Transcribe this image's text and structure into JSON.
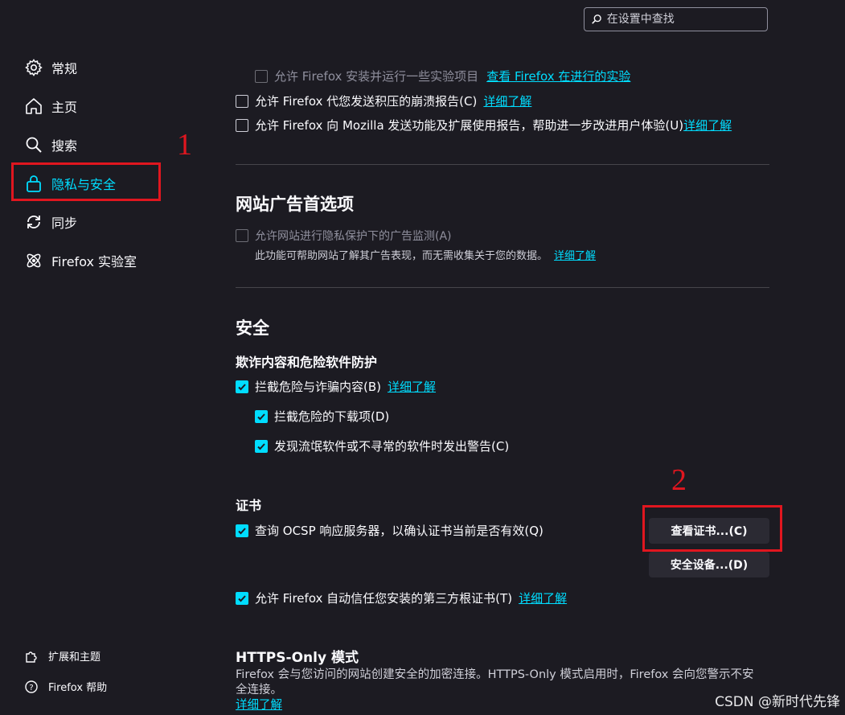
{
  "search": {
    "placeholder": "在设置中查找"
  },
  "sidebar": {
    "items": [
      {
        "label": "常规",
        "icon": "gear-icon"
      },
      {
        "label": "主页",
        "icon": "home-icon"
      },
      {
        "label": "搜索",
        "icon": "search-icon"
      },
      {
        "label": "隐私与安全",
        "icon": "lock-icon",
        "active": true
      },
      {
        "label": "同步",
        "icon": "sync-icon"
      },
      {
        "label": "Firefox 实验室",
        "icon": "flask-icon"
      }
    ],
    "footer": [
      {
        "label": "扩展和主题",
        "icon": "puzzle-icon"
      },
      {
        "label": "Firefox 帮助",
        "icon": "help-icon"
      }
    ]
  },
  "annotations": {
    "one": "1",
    "two": "2",
    "color": "#e0161f"
  },
  "data_collection": {
    "studies_label": "允许 Firefox 安装并运行一些实验项目",
    "studies_link": "查看 Firefox 在进行的实验",
    "crash_label": "允许 Firefox 代您发送积压的崩溃报告(C)",
    "crash_link": "详细了解",
    "telemetry_label": "允许 Firefox 向 Mozilla 发送功能及扩展使用报告，帮助进一步改进用户体验(U)",
    "telemetry_link": "详细了解"
  },
  "ads": {
    "title": "网站广告首选项",
    "ppa_label": "允许网站进行隐私保护下的广告监测(A)",
    "ppa_desc": "此功能可帮助网站了解其广告表现，而无需收集关于您的数据。",
    "ppa_link": "详细了解"
  },
  "security": {
    "title": "安全",
    "phishing_title": "欺诈内容和危险软件防护",
    "block_dangerous": "拦截危险与诈骗内容(B)",
    "block_link": "详细了解",
    "block_downloads": "拦截危险的下载项(D)",
    "warn_unwanted": "发现流氓软件或不寻常的软件时发出警告(C)"
  },
  "certificates": {
    "title": "证书",
    "ocsp_label": "查询 OCSP 响应服务器，以确认证书当前是否有效(Q)",
    "view_button": "查看证书...(C)",
    "devices_button": "安全设备...(D)",
    "enterprise_label": "允许 Firefox 自动信任您安装的第三方根证书(T)",
    "enterprise_link": "详细了解"
  },
  "https_only": {
    "title": "HTTPS-Only 模式",
    "desc_line1": "Firefox 会与您访问的网站创建安全的加密连接。HTTPS-Only 模式启用时，Firefox 会向您警示不安",
    "desc_line2": "全连接。",
    "link": "详细了解"
  },
  "watermark": "CSDN @新时代先锋",
  "colors": {
    "background": "#1c1b22",
    "accent": "#00ddff",
    "text": "#fbfbfe",
    "annotation": "#e0161f"
  }
}
